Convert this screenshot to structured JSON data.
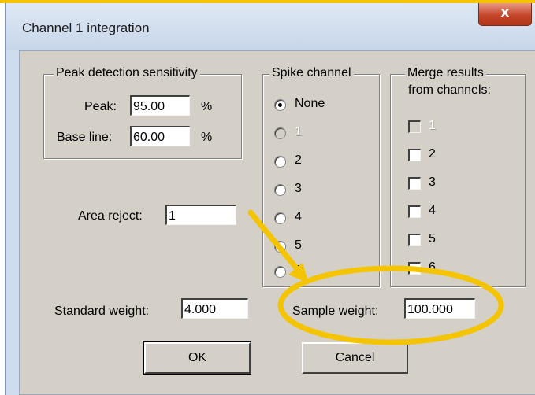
{
  "window": {
    "title": "Channel 1 integration",
    "close_glyph": "x"
  },
  "peak_group": {
    "title": "Peak detection sensitivity",
    "peak_label": "Peak:",
    "peak_value": "95.00",
    "peak_unit": "%",
    "baseline_label": "Base line:",
    "baseline_value": "60.00",
    "baseline_unit": "%"
  },
  "area_reject": {
    "label": "Area reject:",
    "value": "1"
  },
  "spike_group": {
    "title": "Spike channel",
    "options": [
      {
        "label": "None",
        "checked": true,
        "enabled": true
      },
      {
        "label": "1",
        "checked": false,
        "enabled": false
      },
      {
        "label": "2",
        "checked": false,
        "enabled": true
      },
      {
        "label": "3",
        "checked": false,
        "enabled": true
      },
      {
        "label": "4",
        "checked": false,
        "enabled": true
      },
      {
        "label": "5",
        "checked": false,
        "enabled": true
      },
      {
        "label": "6",
        "checked": false,
        "enabled": true
      }
    ]
  },
  "merge_group": {
    "title_line1": "Merge results",
    "title_line2": "from channels:",
    "options": [
      {
        "label": "1",
        "checked": false,
        "enabled": false
      },
      {
        "label": "2",
        "checked": false,
        "enabled": true
      },
      {
        "label": "3",
        "checked": false,
        "enabled": true
      },
      {
        "label": "4",
        "checked": false,
        "enabled": true
      },
      {
        "label": "5",
        "checked": false,
        "enabled": true
      },
      {
        "label": "6",
        "checked": false,
        "enabled": true
      }
    ]
  },
  "standard_weight": {
    "label": "Standard weight:",
    "value": "4.000"
  },
  "sample_weight": {
    "label": "Sample weight:",
    "value": "100.000"
  },
  "buttons": {
    "ok": "OK",
    "cancel": "Cancel"
  },
  "colors": {
    "annotation": "#f5c400",
    "close_button": "#c4462b",
    "dialog_face": "#d4d0c8"
  },
  "icons": {
    "close": "close-icon",
    "annotation_arrow": "arrow-annotation",
    "annotation_ellipse": "ellipse-annotation"
  }
}
